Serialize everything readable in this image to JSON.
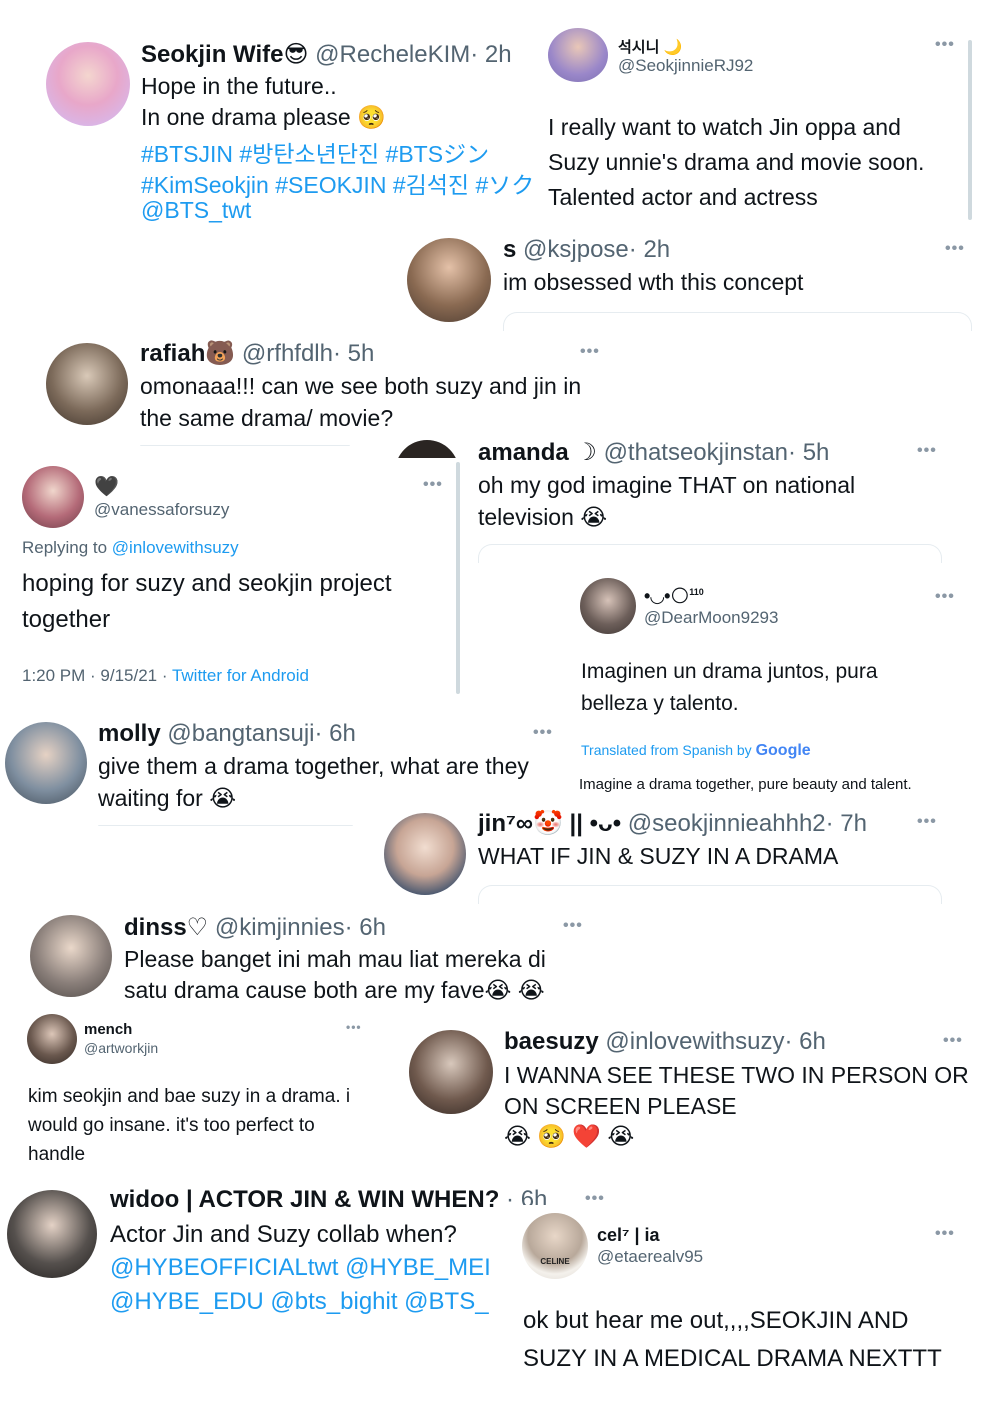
{
  "colors": {
    "link": "#1d9bf0",
    "handle": "#536471",
    "text": "#0f1419",
    "divider": "#e6ecf0"
  },
  "t1": {
    "name": "Seokjin Wife😎",
    "handle": "@RecheleKIM",
    "time": "· 2h",
    "l1": "Hope in the future..",
    "l2": "In one drama please 🥺",
    "h1": "#BTSJIN #방탄소년단진 #BTSジン",
    "h2": "#KimSeokjin #SEOKJIN #김석진 #ソク",
    "h3": "@BTS_twt"
  },
  "t2": {
    "name": "석시니 🌙",
    "handle": "@SeokjinnieRJ92",
    "l1": "I really want to watch Jin oppa and",
    "l2": "Suzy unnie's drama and movie soon.",
    "l3": "Talented actor and actress"
  },
  "t3": {
    "name": "s",
    "handle": "@ksjpose",
    "time": "· 2h",
    "l1": "im obsessed wth this concept"
  },
  "t4": {
    "name": "rafiah🐻",
    "handle": "@rfhfdlh",
    "time": "· 5h",
    "l1": "omonaaa!!! can we see both suzy and jin in",
    "l2": "the same drama/ movie?"
  },
  "t5": {
    "name": "amanda ☽",
    "handle": "@thatseokjinstan",
    "time": "· 5h",
    "l1": "oh my god imagine THAT on national",
    "l2": "television 😭"
  },
  "t6": {
    "name": "🖤",
    "handle": "@vanessaforsuzy",
    "reply_prefix": "Replying to",
    "reply_handle": "@inlovewithsuzy",
    "l1": "hoping for suzy and seokjin project",
    "l2": "together",
    "meta": "1:20 PM · 9/15/21 ·",
    "client": "Twitter for Android"
  },
  "t7": {
    "name": "•◡•🌕",
    "sup": "110",
    "handle": "@DearMoon9293",
    "l1": "Imaginen un drama juntos, pura",
    "l2": "belleza y talento.",
    "translated": "Translated from Spanish by",
    "google": "Google",
    "translation": "Imagine a drama together, pure beauty and talent."
  },
  "t8": {
    "name": "molly",
    "handle": "@bangtansuji",
    "time": "· 6h",
    "l1": "give them a drama together, what are they",
    "l2": "waiting for 😭"
  },
  "t9": {
    "name": "jin⁷∞🤡 || •ᴗ•",
    "handle": "@seokjinnieahhh2",
    "time": "· 7h",
    "l1": "WHAT IF JIN & SUZY IN A DRAMA"
  },
  "t10": {
    "name": "dinss♡",
    "handle": "@kimjinnies",
    "time": "· 6h",
    "l1": "Please banget ini mah mau liat mereka di",
    "l2": "satu drama cause both are my fave😭 😭"
  },
  "t11": {
    "name": "mench",
    "handle": "@artworkjin",
    "l1": "kim seokjin and bae suzy in a drama. i",
    "l2": "would go insane. it's too perfect to",
    "l3": "handle"
  },
  "t12": {
    "name": "baesuzy",
    "handle": "@inlovewithsuzy",
    "time": "· 6h",
    "l1": "I WANNA SEE THESE TWO IN PERSON OR",
    "l2": "ON SCREEN PLEASE",
    "l3": "😭 🥺 ❤️ 😭"
  },
  "t13": {
    "name": "widoo | ACTOR JIN & WIN WHEN?",
    "handle": "",
    "time": "· 6h",
    "l1": "Actor Jin and Suzy collab when?",
    "h1": "@HYBEOFFICIALtwt @HYBE_MEI",
    "h2": "@HYBE_EDU @bts_bighit @BTS_"
  },
  "t14": {
    "name": "cel⁷ | ia",
    "handle": "@etaerealv95",
    "l1": "ok but hear me out,,,,SEOKJIN AND",
    "l2": "SUZY IN A MEDICAL DRAMA NEXTTT",
    "shirt": "CELINE"
  },
  "more_icon": "•••"
}
